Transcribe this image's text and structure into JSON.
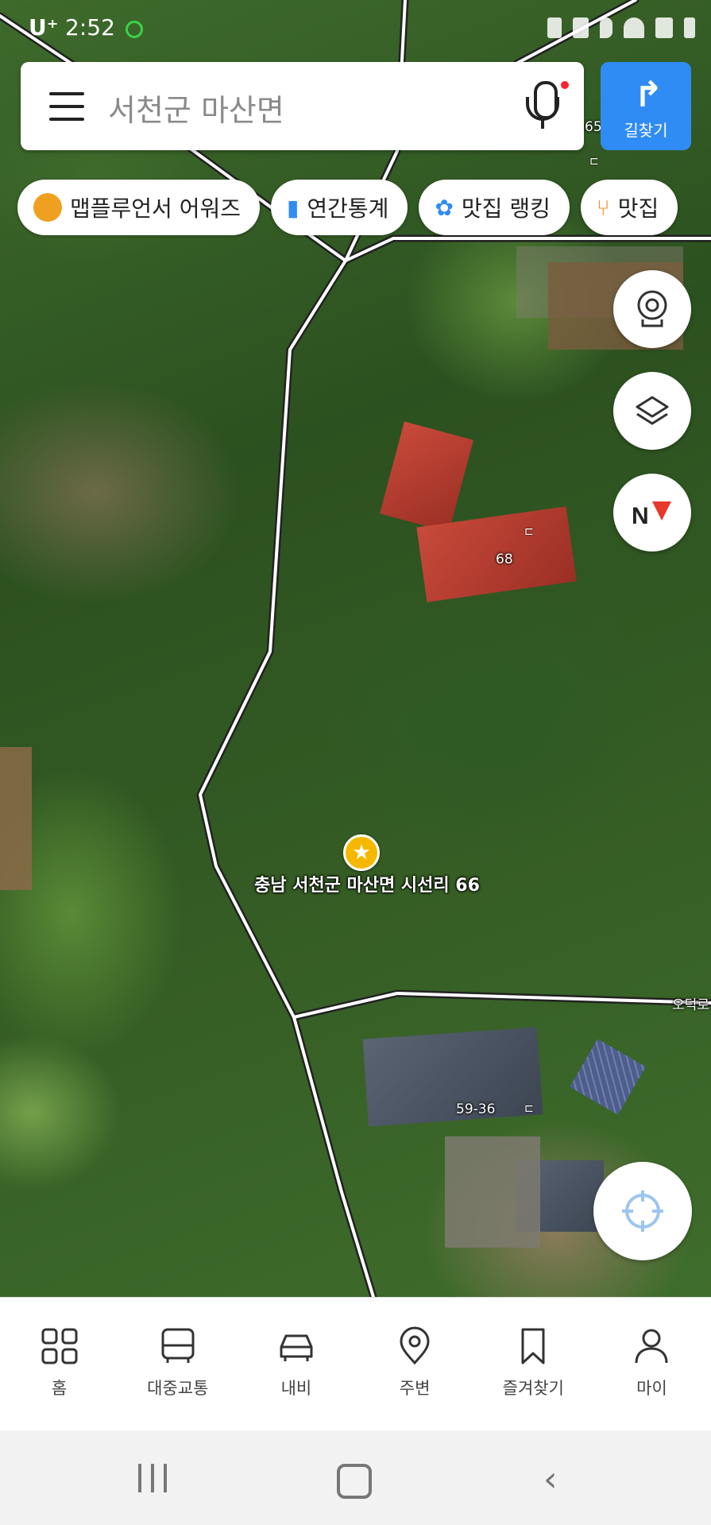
{
  "status_bar": {
    "carrier": "U⁺",
    "time": "2:52"
  },
  "search": {
    "query": "서천군 마산면"
  },
  "directions_button": {
    "label": "길찾기"
  },
  "chips": [
    {
      "label": "맵플루언서 어워즈",
      "icon": "kakao-bear-icon"
    },
    {
      "label": "연간통계",
      "icon": "bar-chart-icon"
    },
    {
      "label": "맛집 랭킹",
      "icon": "ranking-pin-icon"
    },
    {
      "label": "맛집",
      "icon": "utensils-icon"
    }
  ],
  "map": {
    "marker_label": "충남 서천군 마산면 시선리 66",
    "building_numbers": [
      "65",
      "68",
      "59-36"
    ],
    "road_label": "오덕로"
  },
  "bottom_nav": [
    {
      "label": "홈",
      "icon": "grid-icon"
    },
    {
      "label": "대중교통",
      "icon": "bus-icon"
    },
    {
      "label": "내비",
      "icon": "car-icon"
    },
    {
      "label": "주변",
      "icon": "location-pin-icon"
    },
    {
      "label": "즐겨찾기",
      "icon": "bookmark-icon"
    },
    {
      "label": "마이",
      "icon": "person-icon"
    }
  ],
  "colors": {
    "accent": "#2f8cf5",
    "marker": "#f5b800",
    "compass_red": "#e8382b"
  }
}
